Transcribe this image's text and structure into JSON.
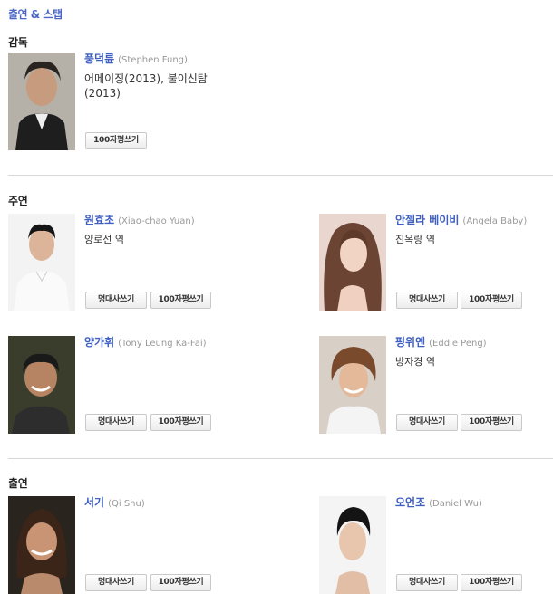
{
  "section_title": "출연 & 스탭",
  "groups": {
    "director": "감독",
    "lead": "주연",
    "cast": "출연"
  },
  "buttons": {
    "quote": "명대사쓰기",
    "review": "100자평쓰기"
  },
  "director": {
    "name": "풍덕륜",
    "en_name": "(Stephen Fung)",
    "works_line1": "어메이징(2013), 불이신탐",
    "works_line2": "(2013)"
  },
  "lead": [
    {
      "name": "원효초",
      "en_name": "(Xiao-chao Yuan)",
      "role": "양로선 역"
    },
    {
      "name": "안젤라 베이비",
      "en_name": "(Angela Baby)",
      "role": "진옥랑 역"
    },
    {
      "name": "양가휘",
      "en_name": "(Tony Leung Ka-Fai)",
      "role": ""
    },
    {
      "name": "펑위옌",
      "en_name": "(Eddie Peng)",
      "role": "방자경 역"
    }
  ],
  "cast": [
    {
      "name": "서기",
      "en_name": "(Qi Shu)",
      "role": ""
    },
    {
      "name": "오언조",
      "en_name": "(Daniel Wu)",
      "role": ""
    }
  ],
  "colors": {
    "accent": "#4a67c5",
    "name": "#3f5fc1",
    "divider": "#d8d8d8"
  }
}
